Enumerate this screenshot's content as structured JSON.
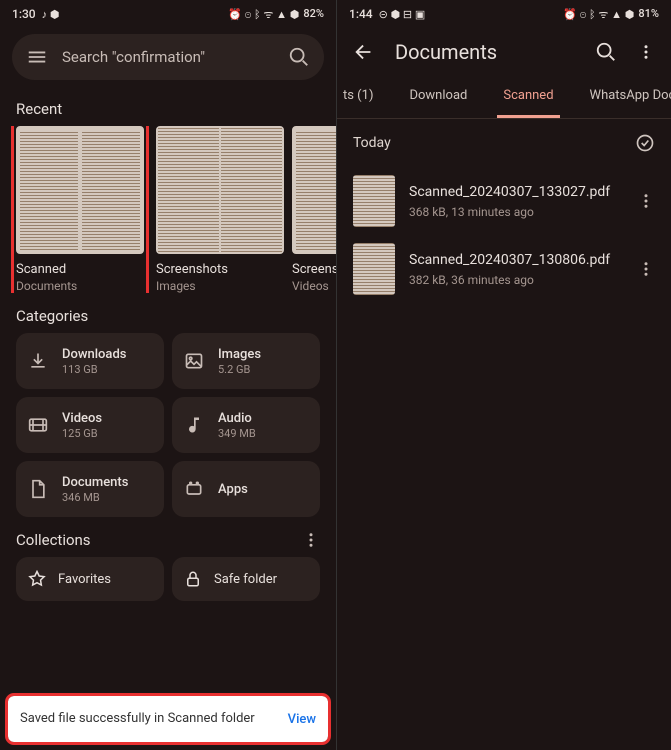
{
  "left": {
    "status": {
      "time": "1:30",
      "battery": "82%"
    },
    "search": {
      "placeholder": "Search \"confirmation\""
    },
    "recent_title": "Recent",
    "recent": [
      {
        "label": "Scanned",
        "sub": "Documents"
      },
      {
        "label": "Screenshots",
        "sub": "Images"
      },
      {
        "label": "Screensh",
        "sub": "Videos"
      }
    ],
    "categories_title": "Categories",
    "categories": [
      {
        "label": "Downloads",
        "size": "113 GB"
      },
      {
        "label": "Images",
        "size": "5.2 GB"
      },
      {
        "label": "Videos",
        "size": "125 GB"
      },
      {
        "label": "Audio",
        "size": "349 MB"
      },
      {
        "label": "Documents",
        "size": "346 MB"
      },
      {
        "label": "Apps",
        "size": ""
      }
    ],
    "collections_title": "Collections",
    "collections": [
      {
        "label": "Favorites"
      },
      {
        "label": "Safe folder"
      }
    ],
    "snackbar": {
      "text": "Saved file successfully in Scanned folder",
      "action": "View"
    }
  },
  "right": {
    "status": {
      "time": "1:44",
      "battery": "81%"
    },
    "title": "Documents",
    "tabs": [
      {
        "label": "ts (1)"
      },
      {
        "label": "Download"
      },
      {
        "label": "Scanned",
        "active": true
      },
      {
        "label": "WhatsApp Docume"
      }
    ],
    "section": "Today",
    "files": [
      {
        "name": "Scanned_20240307_133027.pdf",
        "meta": "368 kB, 13 minutes ago"
      },
      {
        "name": "Scanned_20240307_130806.pdf",
        "meta": "382 kB, 36 minutes ago"
      }
    ]
  }
}
